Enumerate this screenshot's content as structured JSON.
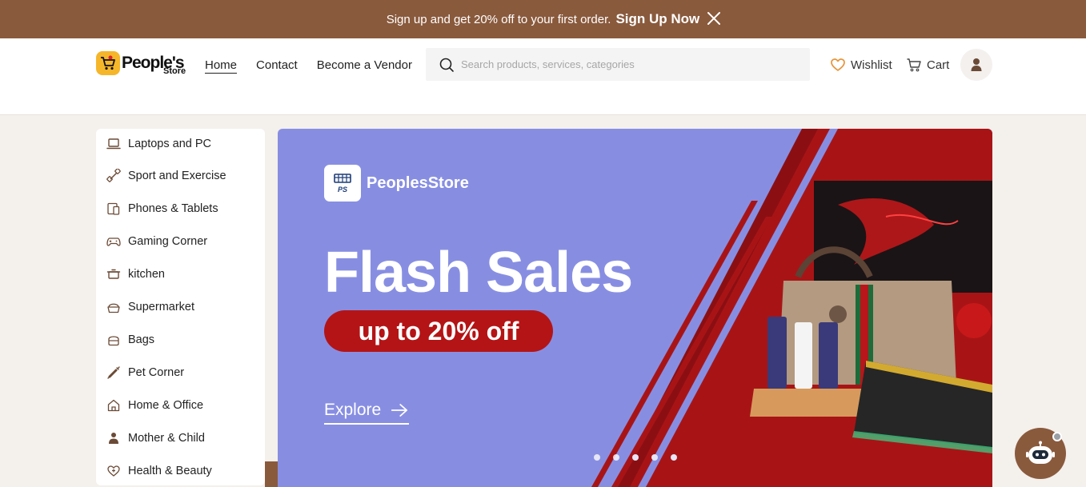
{
  "promo": {
    "text": "Sign up and get 20% off to your first order.",
    "cta": "Sign Up Now"
  },
  "header": {
    "logo_name": "People's",
    "logo_sub": "Store",
    "nav": [
      "Home",
      "Contact",
      "Become a Vendor"
    ],
    "search_placeholder": "Search products, services, categories",
    "wishlist": "Wishlist",
    "cart": "Cart"
  },
  "sidebar": {
    "items": [
      {
        "label": "Laptops and PC",
        "icon": "laptop-icon"
      },
      {
        "label": "Sport and Exercise",
        "icon": "dumbbell-icon"
      },
      {
        "label": "Phones & Tablets",
        "icon": "phone-tablet-icon"
      },
      {
        "label": "Gaming Corner",
        "icon": "gamepad-icon"
      },
      {
        "label": "kitchen",
        "icon": "pot-icon"
      },
      {
        "label": "Supermarket",
        "icon": "basket-icon"
      },
      {
        "label": "Bags",
        "icon": "bag-icon"
      },
      {
        "label": "Pet Corner",
        "icon": "syringe-icon"
      },
      {
        "label": "Home & Office",
        "icon": "home-icon"
      },
      {
        "label": "Mother & Child",
        "icon": "mother-child-icon"
      },
      {
        "label": "Health & Beauty",
        "icon": "health-icon"
      }
    ]
  },
  "banner": {
    "brand": "PeoplesStore",
    "brand_badge": "PS",
    "headline": "Flash Sales",
    "offer": "up to 20% off",
    "explore": "Explore",
    "slides": 5,
    "active_slide": 2
  },
  "colors": {
    "brand_brown": "#8a5a3d",
    "banner_blue": "#878ee2",
    "banner_red": "#b41416",
    "logo_yellow": "#f5b62a",
    "wishlist_orange": "#e8953a"
  }
}
